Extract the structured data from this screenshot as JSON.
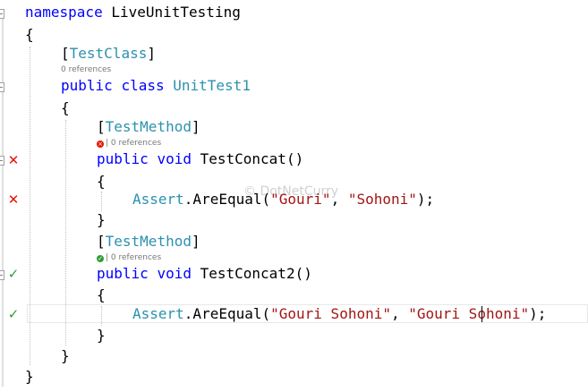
{
  "code": {
    "namespace_kw": "namespace",
    "namespace_name": "LiveUnitTesting",
    "open_brace_1": "{",
    "attr_testclass_open": "[",
    "attr_testclass": "TestClass",
    "attr_testclass_close": "]",
    "class_lens": "0 references",
    "public_kw": "public",
    "class_kw": "class",
    "class_name": "UnitTest1",
    "open_brace_2": "{",
    "attr_testmethod_open": "[",
    "attr_testmethod": "TestMethod",
    "attr_testmethod_close": "]",
    "method1_lens": "| 0 references",
    "void_kw": "void",
    "method1_name": "TestConcat()",
    "open_brace_3": "{",
    "assert_class": "Assert",
    "assert_method": ".AreEqual(",
    "method1_arg1": "\"Gouri\"",
    "sep": ", ",
    "method1_arg2": "\"Sohoni\"",
    "call_end": ");",
    "close_brace_3": "}",
    "method2_lens": "| 0 references",
    "method2_name": "TestConcat2()",
    "open_brace_4": "{",
    "method2_arg1": "\"Gouri Sohoni\"",
    "method2_arg2": "\"Gouri Sohoni\"",
    "close_brace_4": "}",
    "close_brace_2": "}",
    "close_brace_1": "}"
  },
  "gutter": {
    "fail_glyph": "✕",
    "pass_glyph": "✓"
  },
  "watermark": "© DotNetCurry",
  "colors": {
    "keyword": "#0000ff",
    "type": "#2b91af",
    "string": "#a31515",
    "fail": "#e51400",
    "pass": "#2e9e39"
  }
}
